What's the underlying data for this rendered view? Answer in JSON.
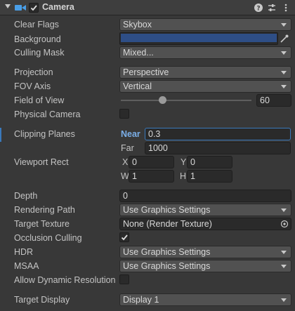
{
  "header": {
    "title": "Camera",
    "enabled": true,
    "icons": [
      "fold-arrow-icon",
      "camera-icon",
      "help-icon",
      "preset-icon",
      "more-menu-icon"
    ]
  },
  "properties": {
    "clear_flags": {
      "label": "Clear Flags",
      "value": "Skybox"
    },
    "background": {
      "label": "Background",
      "color": "#2e4e86"
    },
    "culling_mask": {
      "label": "Culling Mask",
      "value": "Mixed..."
    },
    "projection": {
      "label": "Projection",
      "value": "Perspective"
    },
    "fov_axis": {
      "label": "FOV Axis",
      "value": "Vertical"
    },
    "field_of_view": {
      "label": "Field of View",
      "value": "60",
      "fraction": 0.32
    },
    "physical_camera": {
      "label": "Physical Camera",
      "checked": false
    },
    "clipping_planes": {
      "label": "Clipping Planes",
      "near_label": "Near",
      "near": "0.3",
      "far_label": "Far",
      "far": "1000"
    },
    "viewport_rect": {
      "label": "Viewport Rect",
      "x_label": "X",
      "x": "0",
      "y_label": "Y",
      "y": "0",
      "w_label": "W",
      "w": "1",
      "h_label": "H",
      "h": "1"
    },
    "depth": {
      "label": "Depth",
      "value": "0"
    },
    "rendering_path": {
      "label": "Rendering Path",
      "value": "Use Graphics Settings"
    },
    "target_texture": {
      "label": "Target Texture",
      "value": "None (Render Texture)"
    },
    "occlusion_culling": {
      "label": "Occlusion Culling",
      "checked": true
    },
    "hdr": {
      "label": "HDR",
      "value": "Use Graphics Settings"
    },
    "msaa": {
      "label": "MSAA",
      "value": "Use Graphics Settings"
    },
    "allow_dynamic_resolution": {
      "label": "Allow Dynamic Resolution",
      "checked": false
    },
    "target_display": {
      "label": "Target Display",
      "value": "Display 1"
    }
  }
}
